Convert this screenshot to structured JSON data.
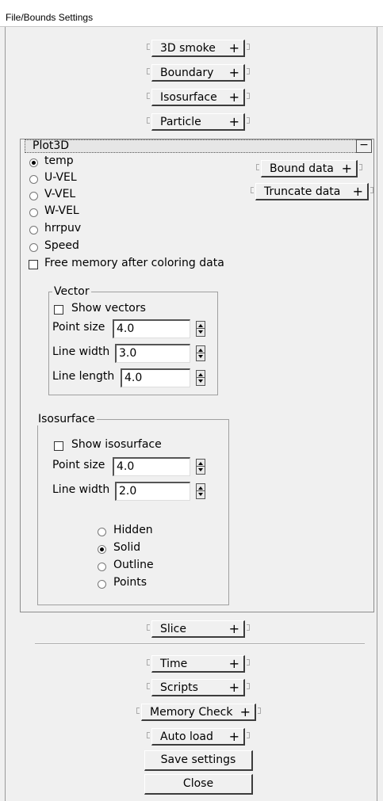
{
  "window": {
    "title": "File/Bounds Settings"
  },
  "rollouts_top": [
    {
      "label": "3D smoke"
    },
    {
      "label": "Boundary"
    },
    {
      "label": "Isosurface"
    },
    {
      "label": "Particle"
    }
  ],
  "plot3d": {
    "title": "Plot3D",
    "collapse_symbol": "−",
    "variables": [
      {
        "label": "temp",
        "selected": true
      },
      {
        "label": "U-VEL",
        "selected": false
      },
      {
        "label": "V-VEL",
        "selected": false
      },
      {
        "label": "W-VEL",
        "selected": false
      },
      {
        "label": "hrrpuv",
        "selected": false
      },
      {
        "label": "Speed",
        "selected": false
      }
    ],
    "free_memory_label": "Free memory after coloring data",
    "bound_data_label": "Bound data",
    "truncate_data_label": "Truncate data",
    "vector": {
      "title": "Vector",
      "show_vectors_label": "Show vectors",
      "point_size_label": "Point size",
      "point_size_value": "4.0",
      "line_width_label": "Line width",
      "line_width_value": "3.0",
      "line_length_label": "Line length",
      "line_length_value": "4.0"
    },
    "isosurface": {
      "title": "Isosurface",
      "show_isosurface_label": "Show isosurface",
      "point_size_label": "Point size",
      "point_size_value": "4.0",
      "line_width_label": "Line width",
      "line_width_value": "2.0",
      "modes": [
        {
          "label": "Hidden",
          "selected": false
        },
        {
          "label": "Solid",
          "selected": true
        },
        {
          "label": "Outline",
          "selected": false
        },
        {
          "label": "Points",
          "selected": false
        }
      ]
    }
  },
  "rollout_slice": {
    "label": "Slice"
  },
  "rollouts_bottom": [
    {
      "label": "Time"
    },
    {
      "label": "Scripts"
    },
    {
      "label": "Memory Check"
    },
    {
      "label": "Auto load"
    }
  ],
  "plus_symbol": "+",
  "buttons": {
    "save": "Save settings",
    "close": "Close"
  }
}
